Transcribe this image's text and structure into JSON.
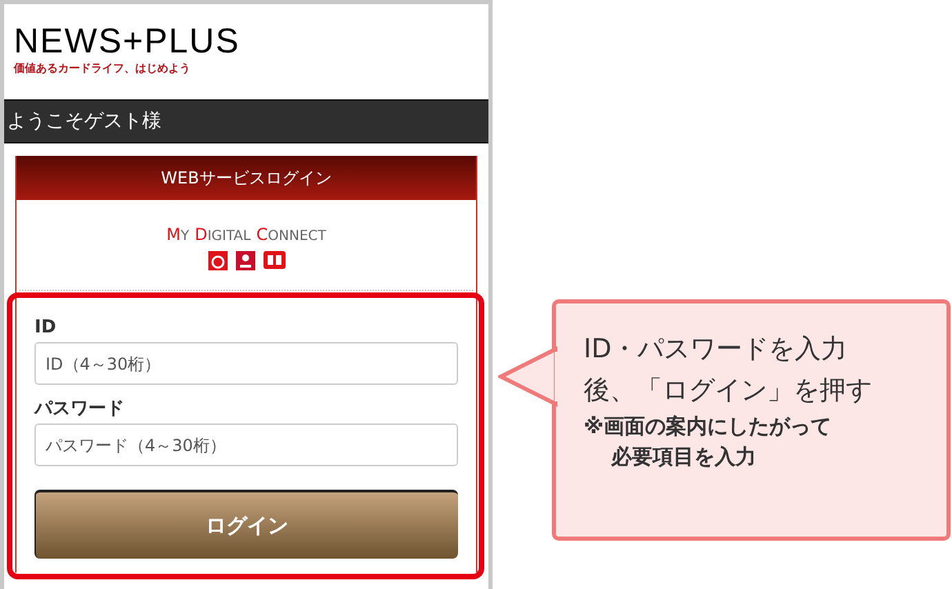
{
  "header": {
    "logo": "NEWS+PLUS",
    "tagline": "価値あるカードライフ、はじめよう"
  },
  "welcome_bar": "ようこそゲスト様",
  "login_card": {
    "title": "WEBサービスログイン",
    "brand_words": [
      "MY",
      "DIGITAL",
      "CONNECT"
    ],
    "fields": [
      {
        "label": "ID",
        "placeholder": "ID（4～30桁）"
      },
      {
        "label": "パスワード",
        "placeholder": "パスワード（4～30桁）"
      }
    ],
    "button": "ログイン"
  },
  "callout": {
    "lines": [
      "ID・パスワードを入力",
      "後、「ログイン」を押す"
    ],
    "note_lines": [
      "※画面の案内にしたがって",
      "必要項目を入力"
    ]
  }
}
